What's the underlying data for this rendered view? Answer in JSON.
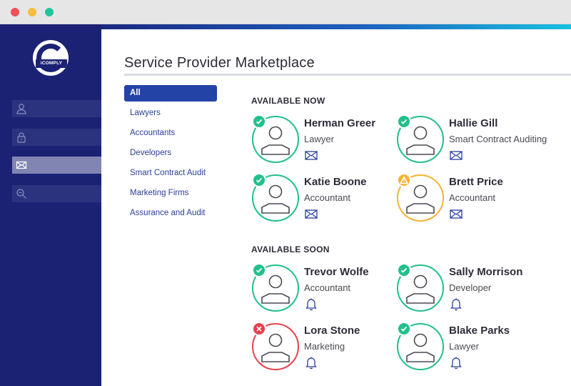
{
  "window": {
    "controls": [
      "close",
      "minimize",
      "maximize"
    ]
  },
  "colors": {
    "sidebar": "#1b2274",
    "accent": "#2343a6",
    "ok": "#22c08a",
    "warn": "#f5b233",
    "error": "#e6424e"
  },
  "sidebar": {
    "logo_text": "iCOMPLY",
    "items": [
      {
        "icon": "user-icon",
        "active": false
      },
      {
        "icon": "lock-icon",
        "active": false
      },
      {
        "icon": "mail-icon",
        "active": true
      },
      {
        "icon": "search-icon",
        "active": false
      }
    ]
  },
  "main": {
    "title": "Service Provider Marketplace",
    "categories": [
      "All",
      "Lawyers",
      "Accountants",
      "Developers",
      "Smart Contract Audit",
      "Marketing Firms",
      "Assurance and Audit"
    ],
    "sections": [
      {
        "label": "AVAILABLE NOW",
        "providers": [
          {
            "name": "Herman Greer",
            "role": "Lawyer",
            "status": "ok",
            "action": "mail-icon"
          },
          {
            "name": "Hallie Gill",
            "role": "Smart Contract Auditing",
            "status": "ok",
            "action": "mail-icon"
          },
          {
            "name": "Katie Boone",
            "role": "Accountant",
            "status": "ok",
            "action": "mail-icon"
          },
          {
            "name": "Brett Price",
            "role": "Accountant",
            "status": "warn",
            "action": "mail-icon"
          }
        ]
      },
      {
        "label": "AVAILABLE SOON",
        "providers": [
          {
            "name": "Trevor Wolfe",
            "role": "Accountant",
            "status": "ok",
            "action": "bell-icon"
          },
          {
            "name": "Sally Morrison",
            "role": "Developer",
            "status": "ok",
            "action": "bell-icon"
          },
          {
            "name": "Lora Stone",
            "role": "Marketing",
            "status": "error",
            "action": "bell-icon"
          },
          {
            "name": "Blake Parks",
            "role": "Lawyer",
            "status": "ok",
            "action": "bell-icon"
          }
        ]
      }
    ]
  }
}
